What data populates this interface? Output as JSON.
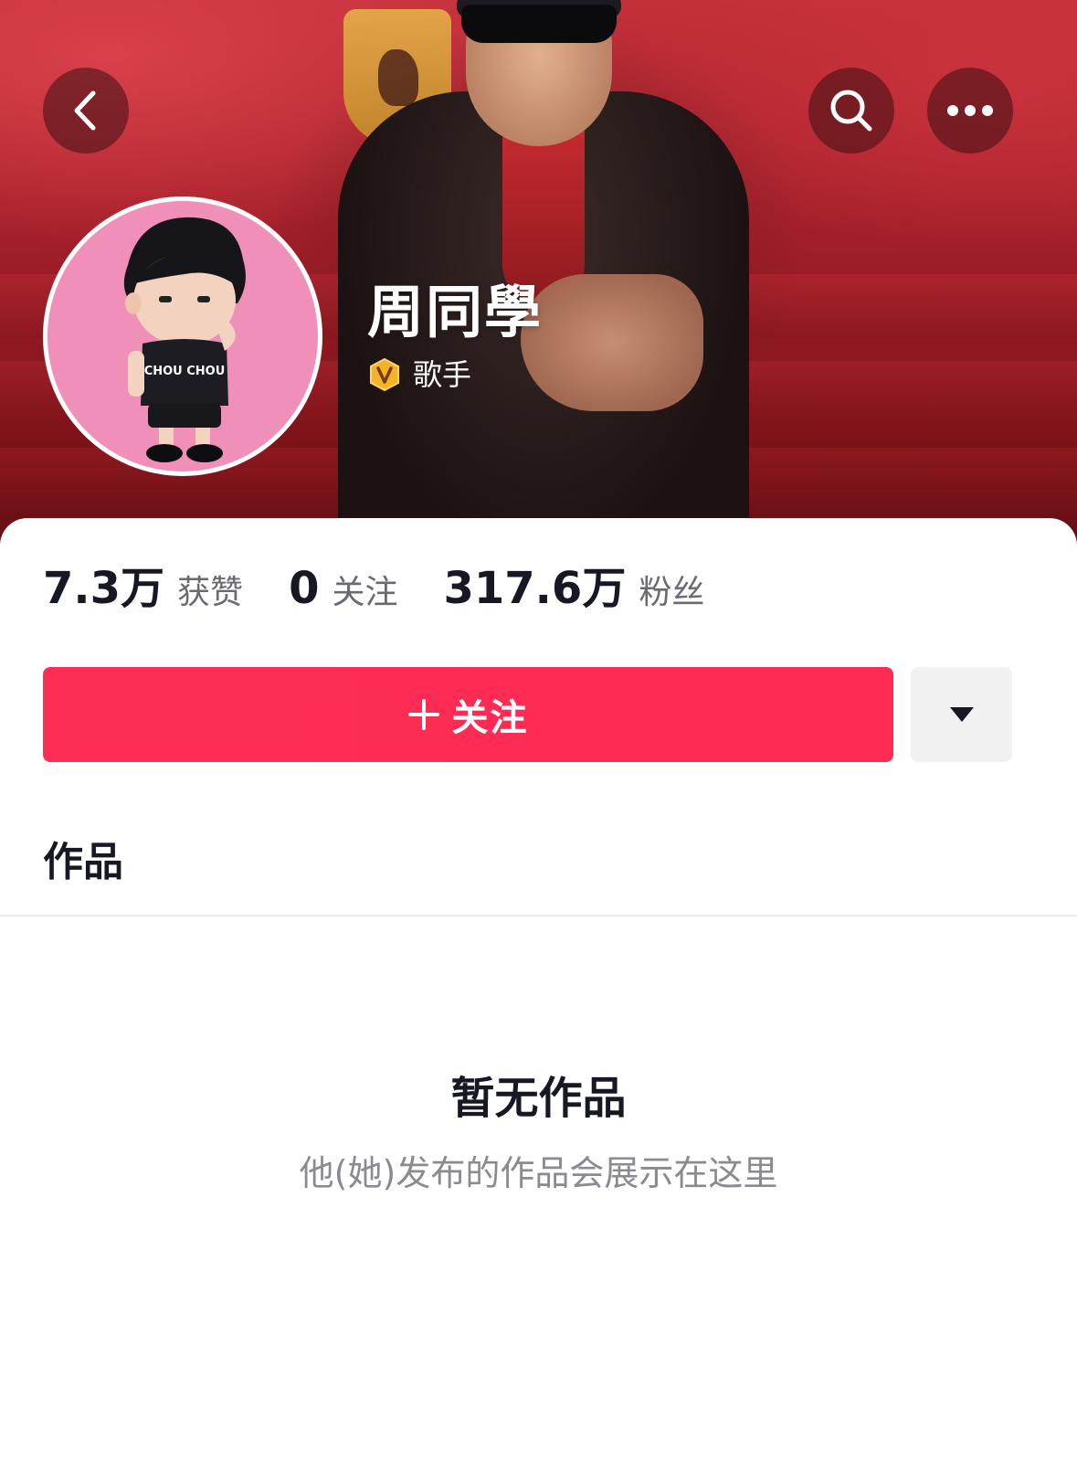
{
  "header": {
    "back_icon": "chevron-left-icon",
    "search_icon": "search-icon",
    "more_icon": "more-horizontal-icon"
  },
  "profile": {
    "name": "周同學",
    "verify_icon": "verified-v-badge-icon",
    "title": "歌手",
    "avatar_text": "CHOU CHOU"
  },
  "stats": {
    "likes": {
      "value": "7.3万",
      "label": "获赞"
    },
    "following": {
      "value": "0",
      "label": "关注"
    },
    "followers": {
      "value": "317.6万",
      "label": "粉丝"
    }
  },
  "actions": {
    "follow_label": "关注",
    "dropdown_icon": "caret-down-icon"
  },
  "tabs": {
    "works_label": "作品"
  },
  "empty_state": {
    "title": "暂无作品",
    "subtitle": "他(她)发布的作品会展示在这里"
  },
  "colors": {
    "accent": "#fe2c55",
    "cover_red": "#a21f29",
    "avatar_bg": "#f090b8",
    "badge_gold": "#f5b32a"
  }
}
